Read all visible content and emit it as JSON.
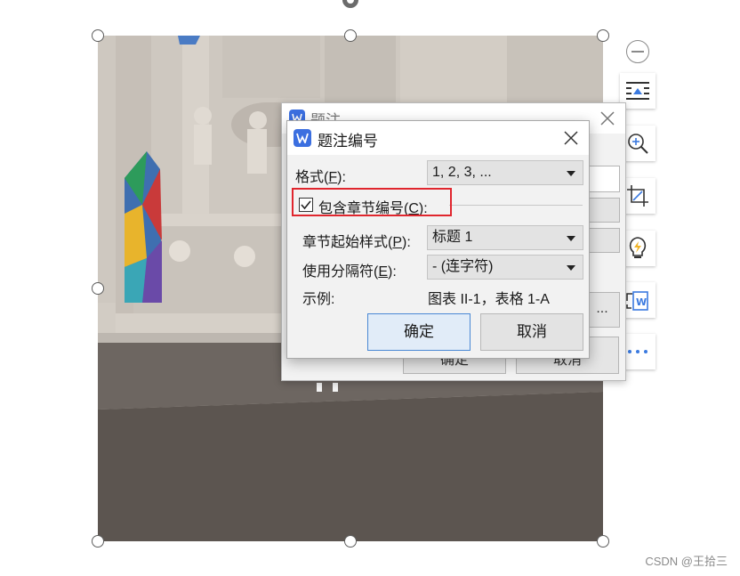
{
  "dialog_back": {
    "title": "题注",
    "ok_label": "确定",
    "cancel_label": "取消",
    "more_label": "..."
  },
  "dialog": {
    "title": "题注编号",
    "format": {
      "label_prefix": "格式(",
      "label_key": "F",
      "label_suffix": "):",
      "value": "1, 2, 3, ..."
    },
    "include_chapter": {
      "label_prefix": "包含章节编号(",
      "label_key": "C",
      "label_suffix": "):",
      "checked": true
    },
    "chapter_style": {
      "label_prefix": "章节起始样式(",
      "label_key": "P",
      "label_suffix": "):",
      "value": "标题 1"
    },
    "separator": {
      "label_prefix": "使用分隔符(",
      "label_key": "E",
      "label_suffix": "):",
      "value": "- (连字符)"
    },
    "example": {
      "label": "示例:",
      "value": "图表 II-1，表格 1-A"
    },
    "ok_label": "确定",
    "cancel_label": "取消"
  },
  "side_toolbar": {
    "icons": [
      "collapse-icon",
      "text-wrap-icon",
      "zoom-in-icon",
      "crop-icon",
      "smart-tool-icon",
      "convert-to-word-icon",
      "more-icon"
    ]
  },
  "watermark": "CSDN @王拾三",
  "colors": {
    "accent": "#4a88d4",
    "highlight": "#e0262e",
    "logo": "#3b6fe0"
  }
}
